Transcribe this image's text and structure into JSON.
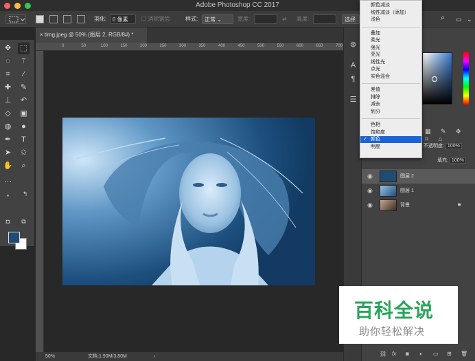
{
  "app_title": "Adobe Photoshop CC 2017",
  "options_bar": {
    "feather_label": "羽化:",
    "feather_value": "0 像素",
    "antialias_label": "消除锯齿",
    "style_label": "样式:",
    "style_value": "正常",
    "width_label": "宽度:",
    "height_label": "高度:",
    "select_and_mask_label": "选择并"
  },
  "document_tab": {
    "label": "timg.jpeg @ 50% (图层 2, RGB/8#) *"
  },
  "ruler_ticks": [
    "0",
    "50",
    "100",
    "150",
    "200",
    "250",
    "300",
    "350",
    "400",
    "450",
    "500",
    "550",
    "600",
    "650",
    "700"
  ],
  "status_bar": {
    "zoom": "50%",
    "doc_info": "文档:1.90M/3.80M"
  },
  "blend_menu": {
    "groups": [
      [
        "颜色减淡",
        "线性减淡（添加）",
        "浅色"
      ],
      [
        "叠加",
        "柔光",
        "强光",
        "亮光",
        "线性光",
        "点光",
        "实色混合"
      ],
      [
        "差值",
        "排除",
        "减去",
        "划分"
      ],
      [
        "色相",
        "饱和度",
        "颜色",
        "明度"
      ]
    ],
    "selected": "颜色",
    "check_mark": "✓"
  },
  "layers_panel": {
    "opacity_label": "不透明度:",
    "opacity_value": "100%",
    "fill_label": "填充:",
    "fill_value": "100%",
    "layers": [
      {
        "name": "图层 2",
        "selected": true
      },
      {
        "name": "图层 1",
        "selected": false
      },
      {
        "name": "背景",
        "selected": false,
        "locked": true
      }
    ]
  },
  "watermark": {
    "title": "百科全说",
    "subtitle": "助你轻松解决"
  },
  "colors": {
    "foreground": "#1f4c74",
    "background": "#ffffff",
    "menu_highlight": "#1d63d8",
    "watermark_green": "#2aa45a"
  }
}
